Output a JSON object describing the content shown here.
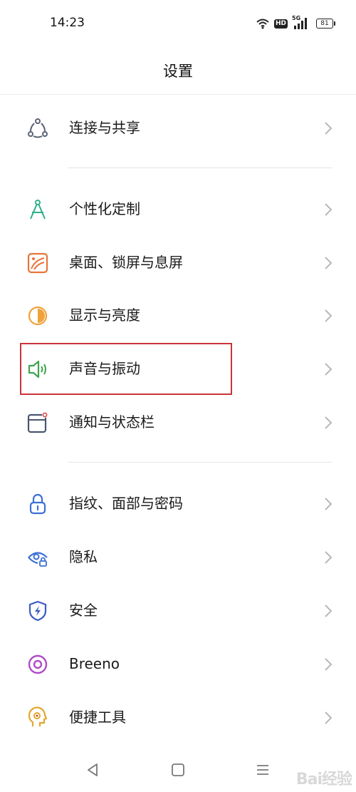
{
  "status_bar": {
    "time": "14:23",
    "hd": "HD",
    "network": "5G",
    "battery": "81"
  },
  "header": {
    "title": "设置"
  },
  "rows": [
    {
      "label": "连接与共享",
      "icon": "share-nodes-icon"
    },
    {
      "label": "个性化定制",
      "icon": "compass-icon"
    },
    {
      "label": "桌面、锁屏与息屏",
      "icon": "wallpaper-icon"
    },
    {
      "label": "显示与亮度",
      "icon": "brightness-icon"
    },
    {
      "label": "声音与振动",
      "icon": "speaker-icon"
    },
    {
      "label": "通知与状态栏",
      "icon": "notification-icon"
    },
    {
      "label": "指纹、面部与密码",
      "icon": "lock-icon"
    },
    {
      "label": "隐私",
      "icon": "privacy-eye-icon"
    },
    {
      "label": "安全",
      "icon": "shield-icon"
    },
    {
      "label": "Breeno",
      "icon": "breeno-icon"
    },
    {
      "label": "便捷工具",
      "icon": "convenience-tools-icon"
    }
  ],
  "colors": {
    "highlight": "#c9343a",
    "share": "#5a6275",
    "personalize": "#2fb08a",
    "wallpaper": "#e8743b",
    "display": "#f0a23a",
    "sound": "#3fa34d",
    "notification": "#4a5670",
    "lock": "#3b6fd6",
    "privacy": "#3b6fd6",
    "security": "#3b5bc4",
    "breeno": "#b04bc9",
    "tools": "#e3a72a"
  },
  "watermark": "Bai经验"
}
